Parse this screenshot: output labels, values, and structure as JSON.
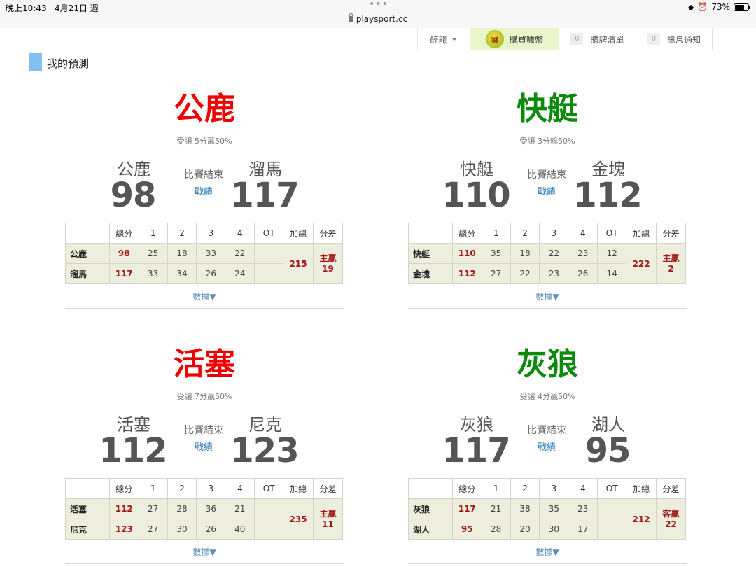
{
  "status_bar": {
    "time": "晚上10:43",
    "date": "4月21日 週一",
    "url": "playsport.cc",
    "battery": "73%",
    "battery_level": 0.73
  },
  "nav": {
    "user": "醉龍",
    "buy": "購買噱幣",
    "coin_glyph": "噱",
    "list_count": "0",
    "list_label": "購牌清單",
    "notify_count": "0",
    "notify_label": "訊息通知"
  },
  "section": {
    "title": "我的預測"
  },
  "table_headers": [
    "總分",
    "1",
    "2",
    "3",
    "4",
    "OT",
    "加總",
    "分差"
  ],
  "games": [
    {
      "pick": "公鹿",
      "pick_color": "#ee0000",
      "spread": "受讓 5分贏50%",
      "status": "比賽結束",
      "record": "戰績",
      "stats_link": "數據▼",
      "team1": {
        "name": "公鹿",
        "score": "98",
        "quarters": [
          "25",
          "18",
          "33",
          "22"
        ],
        "ot": ""
      },
      "team2": {
        "name": "溜馬",
        "score": "117",
        "quarters": [
          "33",
          "34",
          "26",
          "24"
        ],
        "ot": ""
      },
      "sum": "215",
      "diff_label": "主贏",
      "diff_value": "19"
    },
    {
      "pick": "快艇",
      "pick_color": "#0b8a0b",
      "spread": "受讓 3分輸50%",
      "status": "比賽結束",
      "record": "戰績",
      "stats_link": "數據▼",
      "team1": {
        "name": "快艇",
        "score": "110",
        "quarters": [
          "35",
          "18",
          "22",
          "23"
        ],
        "ot": "12"
      },
      "team2": {
        "name": "金塊",
        "score": "112",
        "quarters": [
          "27",
          "22",
          "23",
          "26"
        ],
        "ot": "14"
      },
      "sum": "222",
      "diff_label": "主贏",
      "diff_value": "2"
    },
    {
      "pick": "活塞",
      "pick_color": "#ee0000",
      "spread": "受讓 7分贏50%",
      "status": "比賽結束",
      "record": "戰績",
      "stats_link": "數據▼",
      "team1": {
        "name": "活塞",
        "score": "112",
        "quarters": [
          "27",
          "28",
          "36",
          "21"
        ],
        "ot": ""
      },
      "team2": {
        "name": "尼克",
        "score": "123",
        "quarters": [
          "27",
          "30",
          "26",
          "40"
        ],
        "ot": ""
      },
      "sum": "235",
      "diff_label": "主贏",
      "diff_value": "11"
    },
    {
      "pick": "灰狼",
      "pick_color": "#0b8a0b",
      "spread": "受讓 4分贏50%",
      "status": "比賽結束",
      "record": "戰績",
      "stats_link": "數據▼",
      "team1": {
        "name": "灰狼",
        "score": "117",
        "quarters": [
          "21",
          "38",
          "35",
          "23"
        ],
        "ot": ""
      },
      "team2": {
        "name": "湖人",
        "score": "95",
        "quarters": [
          "28",
          "20",
          "30",
          "17"
        ],
        "ot": ""
      },
      "sum": "212",
      "diff_label": "客贏",
      "diff_value": "22"
    }
  ]
}
